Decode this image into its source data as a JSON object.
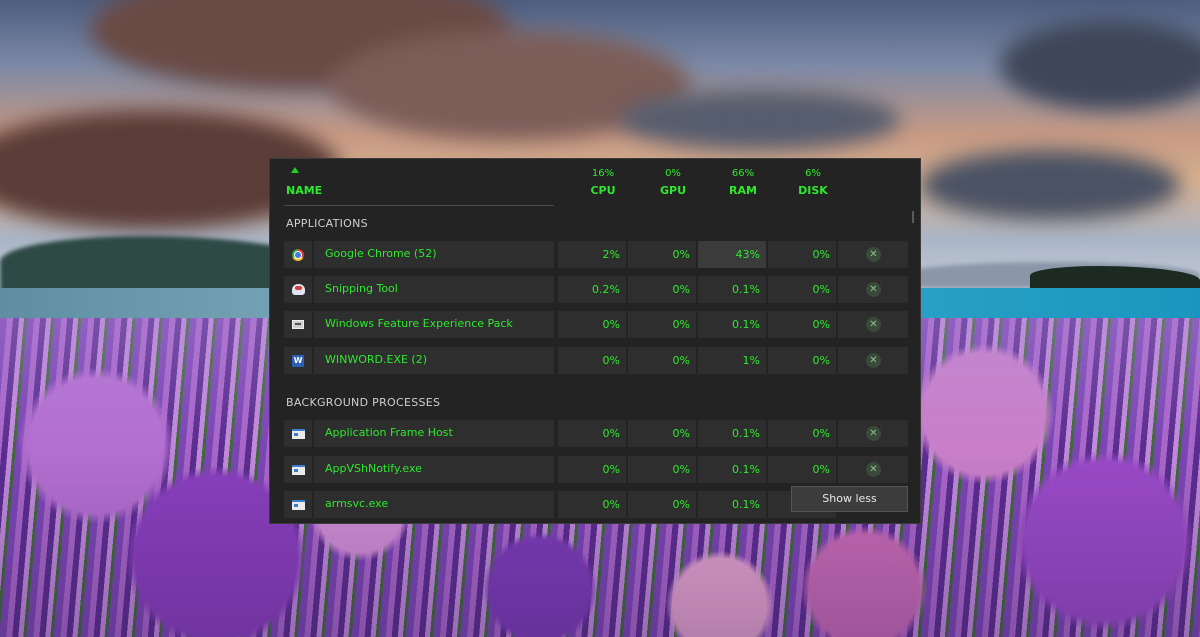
{
  "header": {
    "name_label": "NAME",
    "columns": [
      {
        "key": "cpu",
        "label": "CPU",
        "percent": "16%"
      },
      {
        "key": "gpu",
        "label": "GPU",
        "percent": "0%"
      },
      {
        "key": "ram",
        "label": "RAM",
        "percent": "66%"
      },
      {
        "key": "disk",
        "label": "DISK",
        "percent": "6%"
      }
    ]
  },
  "sections": {
    "applications": {
      "title": "APPLICATIONS",
      "rows": [
        {
          "name": "Google Chrome (52)",
          "icon": "chrome-icon",
          "cpu": "2%",
          "gpu": "0%",
          "ram": "43%",
          "disk": "0%"
        },
        {
          "name": "Snipping Tool",
          "icon": "snipping-tool-icon",
          "cpu": "0.2%",
          "gpu": "0%",
          "ram": "0.1%",
          "disk": "0%"
        },
        {
          "name": "Windows Feature Experience Pack",
          "icon": "feature-pack-icon",
          "cpu": "0%",
          "gpu": "0%",
          "ram": "0.1%",
          "disk": "0%"
        },
        {
          "name": "WINWORD.EXE (2)",
          "icon": "word-icon",
          "cpu": "0%",
          "gpu": "0%",
          "ram": "1%",
          "disk": "0%"
        }
      ]
    },
    "background": {
      "title": "BACKGROUND PROCESSES",
      "rows": [
        {
          "name": "Application Frame Host",
          "icon": "app-window-icon",
          "cpu": "0%",
          "gpu": "0%",
          "ram": "0.1%",
          "disk": "0%"
        },
        {
          "name": "AppVShNotify.exe",
          "icon": "app-window-icon",
          "cpu": "0%",
          "gpu": "0%",
          "ram": "0.1%",
          "disk": "0%"
        },
        {
          "name": "armsvc.exe",
          "icon": "app-window-icon",
          "cpu": "0%",
          "gpu": "0%",
          "ram": "0.1%",
          "disk": ""
        }
      ]
    }
  },
  "tooltip": {
    "label": "Show less"
  },
  "colors": {
    "accent": "#2ee82e",
    "panel_bg": "#232323",
    "row_bg": "#2e2e2e"
  }
}
